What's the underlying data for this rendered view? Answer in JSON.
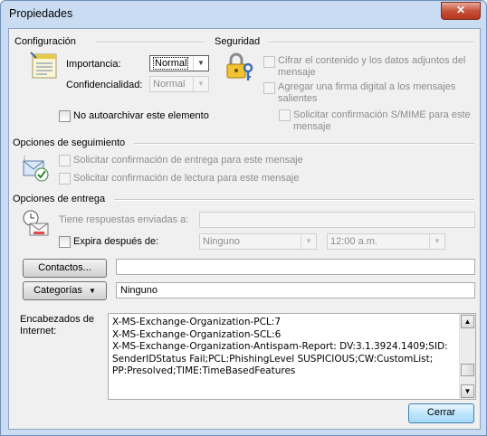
{
  "window": {
    "title": "Propiedades",
    "close_glyph": "✕"
  },
  "config": {
    "heading": "Configuración",
    "importance_label": "Importancia:",
    "importance_value": "Normal",
    "confidentiality_label": "Confidencialidad:",
    "confidentiality_value": "Normal",
    "no_autoarchive_label": "No autoarchivar este elemento"
  },
  "security": {
    "heading": "Seguridad",
    "encrypt_label_1": "Cifrar el contenido y los datos adjuntos del",
    "encrypt_label_2": "mensaje",
    "sign_label_1": "Agregar una firma digital a los mensajes",
    "sign_label_2": "salientes",
    "smime_label_1": "Solicitar confirmación S/MIME para este",
    "smime_label_2": "mensaje"
  },
  "tracking": {
    "heading": "Opciones de seguimiento",
    "delivery_label": "Solicitar confirmación de entrega para este mensaje",
    "read_label": "Solicitar confirmación de lectura para este mensaje"
  },
  "delivery": {
    "heading": "Opciones de entrega",
    "replies_label": "Tiene respuestas enviadas a:",
    "replies_value": "",
    "expires_label": "Expira después de:",
    "expires_date": "Ninguno",
    "expires_time": "12:00 a.m."
  },
  "contacts": {
    "button_label": "Contactos...",
    "value": ""
  },
  "categories": {
    "button_label": "Categorías",
    "value": "Ninguno"
  },
  "headers": {
    "label_1": "Encabezados de",
    "label_2": "Internet:",
    "text": "X-MS-Exchange-Organization-PCL:7\nX-MS-Exchange-Organization-SCL:6\nX-MS-Exchange-Organization-Antispam-Report: DV:3.1.3924.1409;SID:\nSenderIDStatus Fail;PCL:PhishingLevel SUSPICIOUS;CW:CustomList;\nPP:Presolved;TIME:TimeBasedFeatures"
  },
  "footer": {
    "close_label": "Cerrar"
  },
  "icons": [
    "note-icon",
    "lock-key-icon",
    "tracking-check-icon",
    "clock-envelope-icon",
    "chevron-down-icon",
    "scroll-up-icon",
    "scroll-down-icon"
  ]
}
